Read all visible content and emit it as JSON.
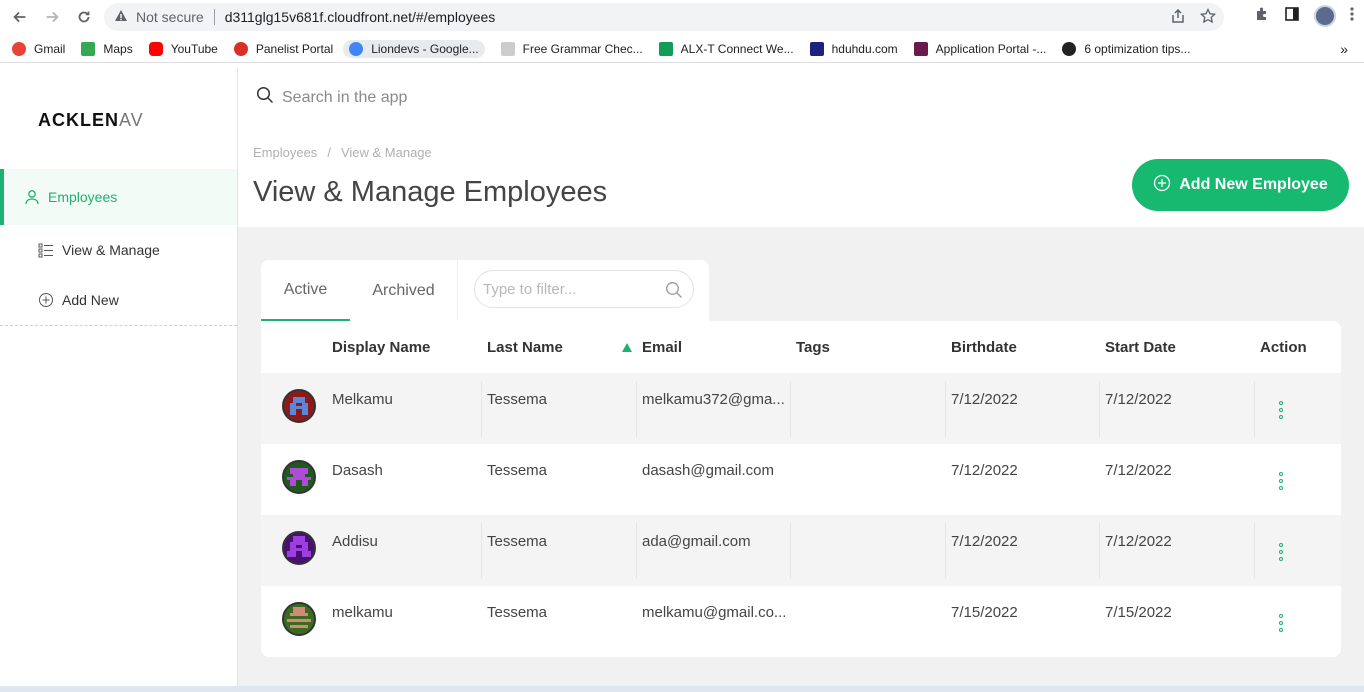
{
  "browser": {
    "not_secure": "Not secure",
    "url": "d311glg15v681f.cloudfront.net/#/employees",
    "bookmarks": [
      {
        "label": "Gmail",
        "color": "#ea4335"
      },
      {
        "label": "Maps",
        "color": "#34a853"
      },
      {
        "label": "YouTube",
        "color": "#ff0000"
      },
      {
        "label": "Panelist Portal",
        "color": "#d93025"
      },
      {
        "label": "Liondevs - Google...",
        "color": "#4285f4"
      },
      {
        "label": "Free Grammar Chec...",
        "color": "#555555"
      },
      {
        "label": "ALX-T Connect We...",
        "color": "#0f9d58"
      },
      {
        "label": "hduhdu.com",
        "color": "#1a237e"
      },
      {
        "label": "Application Portal -...",
        "color": "#6a1b4d"
      },
      {
        "label": "6 optimization tips...",
        "color": "#222222"
      }
    ],
    "more": "»"
  },
  "sidebar": {
    "logo_main": "ACKLEN",
    "logo_fade": "AV",
    "items": [
      {
        "label": "Employees"
      },
      {
        "label": "View & Manage"
      },
      {
        "label": "Add New"
      }
    ]
  },
  "header": {
    "search_placeholder": "Search in the app",
    "breadcrumb": [
      "Employees",
      "View & Manage"
    ],
    "breadcrumb_sep": "/",
    "title": "View & Manage Employees",
    "add_button": "Add New Employee"
  },
  "tabs": {
    "active": "Active",
    "archived": "Archived",
    "filter_placeholder": "Type to filter..."
  },
  "table": {
    "columns": [
      "Display Name",
      "Last Name",
      "Email",
      "Tags",
      "Birthdate",
      "Start Date",
      "Action"
    ],
    "rows": [
      {
        "display_name": "Melkamu",
        "last_name": "Tessema",
        "email": "melkamu372@gma...",
        "tags": "",
        "birthdate": "7/12/2022",
        "start_date": "7/12/2022",
        "avatar_bg": "#8b1a1a",
        "avatar_fg": "#5c86d6"
      },
      {
        "display_name": "Dasash",
        "last_name": "Tessema",
        "email": "dasash@gmail.com",
        "tags": "",
        "birthdate": "7/12/2022",
        "start_date": "7/12/2022",
        "avatar_bg": "#1e5a1e",
        "avatar_fg": "#b04ad8"
      },
      {
        "display_name": "Addisu",
        "last_name": "Tessema",
        "email": "ada@gmail.com",
        "tags": "",
        "birthdate": "7/12/2022",
        "start_date": "7/12/2022",
        "avatar_bg": "#4a1070",
        "avatar_fg": "#9d3fe0"
      },
      {
        "display_name": "melkamu",
        "last_name": "Tessema",
        "email": "melkamu@gmail.co...",
        "tags": "",
        "birthdate": "7/15/2022",
        "start_date": "7/15/2022",
        "avatar_bg": "#3a6b1e",
        "avatar_fg": "#d08a7a"
      }
    ]
  },
  "colors": {
    "accent": "#1db172",
    "button": "#17b971"
  }
}
